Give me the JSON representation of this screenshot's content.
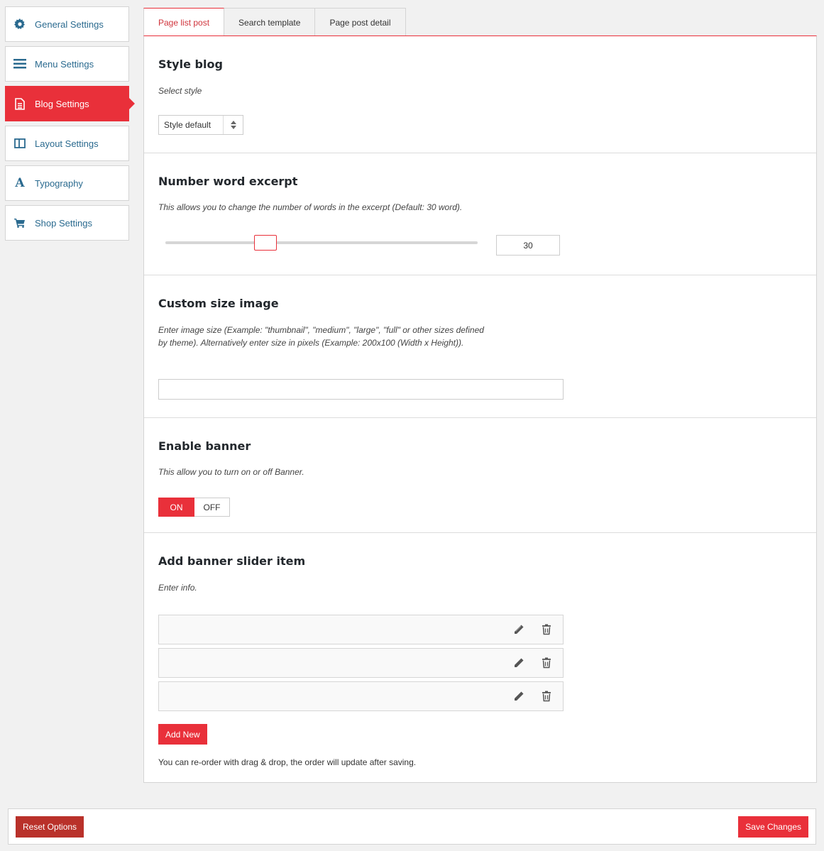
{
  "sidebar": {
    "items": [
      {
        "label": "General Settings",
        "icon": "gear-icon"
      },
      {
        "label": "Menu Settings",
        "icon": "menu-lines-icon"
      },
      {
        "label": "Blog Settings",
        "icon": "document-icon",
        "active": true
      },
      {
        "label": "Layout Settings",
        "icon": "layout-columns-icon"
      },
      {
        "label": "Typography",
        "icon": "typography-a-icon"
      },
      {
        "label": "Shop Settings",
        "icon": "cart-icon"
      }
    ]
  },
  "tabs": [
    {
      "label": "Page list post",
      "active": true
    },
    {
      "label": "Search template"
    },
    {
      "label": "Page post detail"
    }
  ],
  "sections": {
    "style_blog": {
      "title": "Style blog",
      "desc": "Select style",
      "select_value": "Style default"
    },
    "word_excerpt": {
      "title": "Number word excerpt",
      "desc": "This allows you to change the number of words in the excerpt (Default: 30 word).",
      "value": "30"
    },
    "custom_size": {
      "title": "Custom size image",
      "desc": "Enter image size (Example: \"thumbnail\", \"medium\", \"large\", \"full\" or other sizes defined by theme). Alternatively enter size in pixels (Example: 200x100 (Width x Height)).",
      "value": ""
    },
    "enable_banner": {
      "title": "Enable banner",
      "desc": "This allow you to turn on or off Banner.",
      "on_label": "ON",
      "off_label": "OFF",
      "state": "ON"
    },
    "banner_slider": {
      "title": "Add banner slider item",
      "desc": "Enter info.",
      "add_label": "Add New",
      "note": "You can re-order with drag & drop, the order will update after saving."
    }
  },
  "footer": {
    "reset_label": "Reset Options",
    "save_label": "Save Changes"
  },
  "colors": {
    "accent": "#e9303a",
    "reset": "#b9312a",
    "link": "#2a6a8f"
  }
}
